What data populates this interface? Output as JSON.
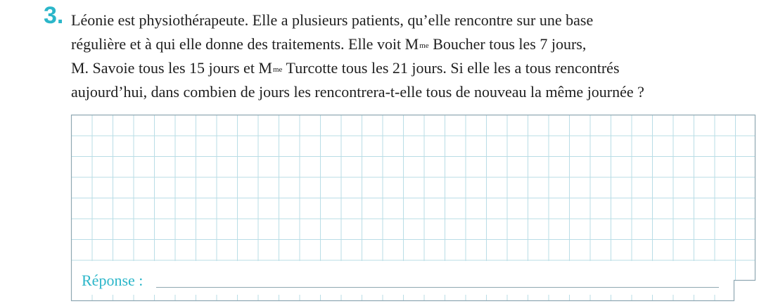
{
  "question": {
    "number": "3.",
    "line1": "Léonie est physiothérapeute. Elle a plusieurs patients, qu’elle rencontre sur une base",
    "line2_a": "régulière et à qui elle donne des traitements. Elle voit M",
    "line2_sup": "me",
    "line2_b": " Boucher tous les 7 jours,",
    "line3_a": "M. Savoie tous les 15 jours et M",
    "line3_sup": "me",
    "line3_b": " Turcotte tous les 21 jours. Si elle les a tous rencontrés",
    "line4": "aujourd’hui, dans combien de jours les rencontrera-t-elle tous de nouveau la même journée ?"
  },
  "answer": {
    "label": "Réponse :",
    "value": ""
  },
  "colors": {
    "accent": "#2bb6c9",
    "grid": "#b9dde6",
    "border": "#8fa8b2"
  }
}
